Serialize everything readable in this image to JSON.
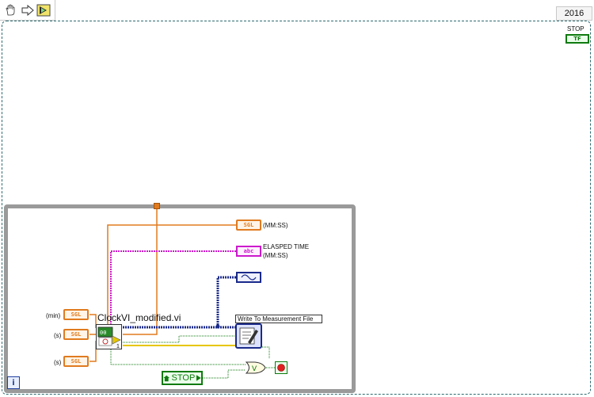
{
  "toolbar": {
    "run_mode_icon": "hand-icon",
    "step_icon": "arrow-right-icon",
    "run_icon": "run-arrow-icon"
  },
  "version": "2016",
  "outer_loop": {
    "stop_label": "STOP",
    "stop_terminal": "TF"
  },
  "inner_loop": {
    "iteration_label": "i"
  },
  "controls": [
    {
      "label": "(min)",
      "type": "SGL"
    },
    {
      "label": "(s)",
      "type": "SGL"
    },
    {
      "label": "(s)",
      "type": "SGL"
    }
  ],
  "indicators": {
    "mmss": {
      "label": "(MM:SS)",
      "type": "SGL"
    },
    "elapsed": {
      "label_line1": "ELASPED TIME",
      "label_line2": "(MM:SS)",
      "type": "abc"
    }
  },
  "subvi": {
    "label": "ClockVI_modified.vi",
    "sub_text": "1"
  },
  "express_vi": {
    "label": "Write To Measurement File"
  },
  "stop_control": {
    "label": "STOP"
  },
  "colors": {
    "orange_wire": "#e07b1f",
    "pink_wire": "#cc19cc",
    "blue_wire": "#1a2a8a",
    "green_wire": "#0f7a0f",
    "yellow_wire": "#e6c600"
  }
}
